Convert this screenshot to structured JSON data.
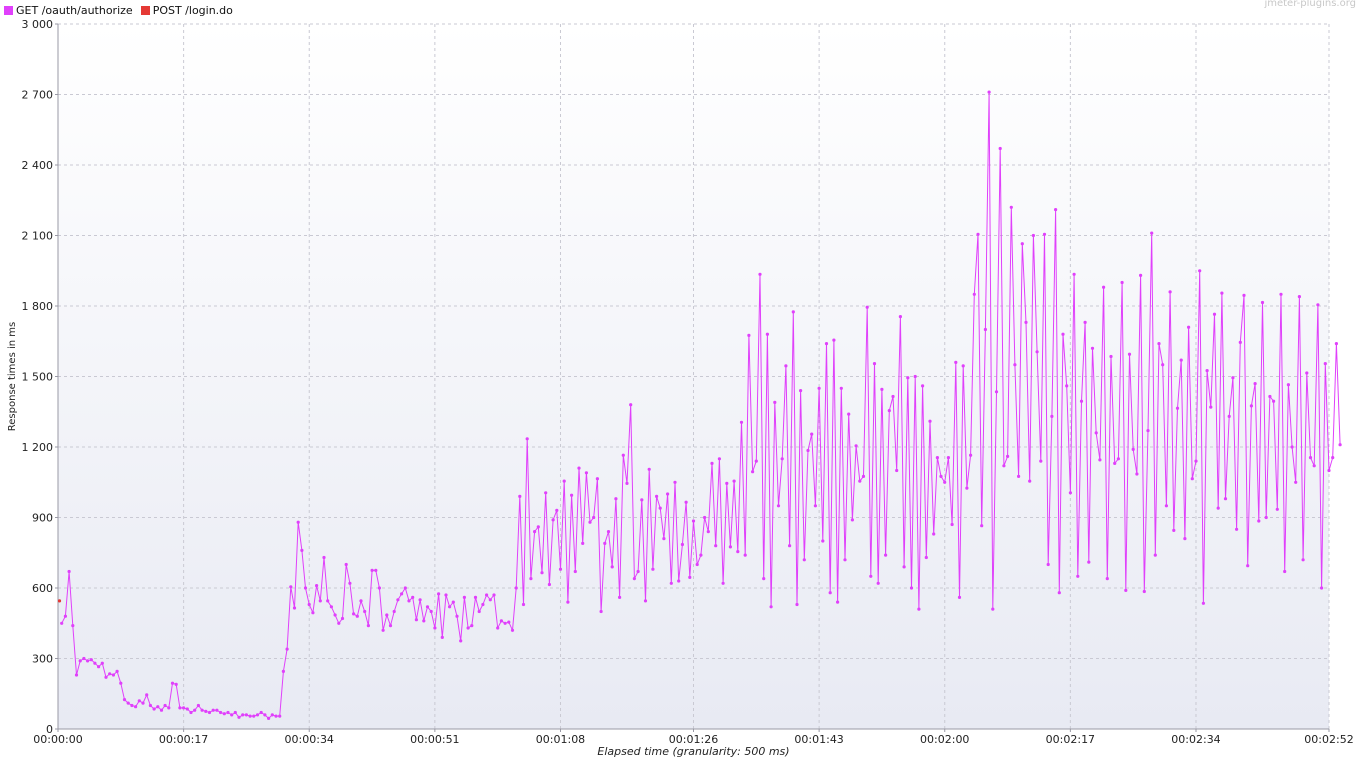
{
  "legend": {
    "items": [
      {
        "label": "GET /oauth/authorize",
        "color": "#e040fb"
      },
      {
        "label": "POST /login.do",
        "color": "#e53935"
      }
    ]
  },
  "watermark": "jmeter-plugins.org",
  "chart_data": {
    "type": "line",
    "title": "",
    "xlabel": "Elapsed time (granularity: 500 ms)",
    "ylabel": "Response times in ms",
    "xlim": [
      0,
      172
    ],
    "ylim": [
      0,
      3000
    ],
    "yticks": [
      0,
      300,
      600,
      900,
      1200,
      1500,
      1800,
      2100,
      2400,
      2700,
      3000
    ],
    "ytick_labels": [
      "0",
      "300",
      "600",
      "900",
      "1 200",
      "1 500",
      "1 800",
      "2 100",
      "2 400",
      "2 700",
      "3 000"
    ],
    "xticks": [
      0,
      17,
      34,
      51,
      68,
      86,
      103,
      120,
      137,
      154,
      172
    ],
    "xtick_labels": [
      "00:00:00",
      "00:00:17",
      "00:00:34",
      "00:00:51",
      "00:01:08",
      "00:01:26",
      "00:01:43",
      "00:02:00",
      "00:02:17",
      "00:02:34",
      "00:02:52"
    ],
    "grid": true,
    "legend_position": "top-left",
    "series": [
      {
        "name": "GET /oauth/authorize",
        "color": "#e040fb",
        "x_start": 0.5,
        "x_step": 0.5,
        "values": [
          450,
          480,
          670,
          440,
          230,
          290,
          300,
          290,
          295,
          280,
          265,
          280,
          220,
          235,
          230,
          245,
          195,
          125,
          110,
          100,
          95,
          120,
          110,
          145,
          100,
          85,
          95,
          80,
          100,
          90,
          195,
          190,
          90,
          90,
          85,
          70,
          80,
          100,
          80,
          75,
          70,
          80,
          80,
          70,
          65,
          70,
          60,
          70,
          50,
          60,
          60,
          55,
          55,
          60,
          70,
          60,
          45,
          60,
          55,
          55,
          245,
          340,
          605,
          515,
          880,
          760,
          600,
          530,
          495,
          610,
          545,
          730,
          545,
          520,
          485,
          450,
          470,
          700,
          620,
          490,
          480,
          545,
          500,
          440,
          675,
          675,
          600,
          420,
          485,
          440,
          500,
          550,
          575,
          600,
          545,
          560,
          465,
          550,
          460,
          520,
          500,
          430,
          575,
          390,
          570,
          520,
          540,
          480,
          375,
          560,
          430,
          440,
          560,
          500,
          530,
          570,
          550,
          570,
          430,
          460,
          450,
          455,
          420,
          600,
          990,
          530,
          1235,
          640,
          840,
          860,
          665,
          1005,
          615,
          890,
          930,
          680,
          1055,
          540,
          995,
          670,
          1110,
          790,
          1090,
          880,
          900,
          1065,
          500,
          790,
          840,
          690,
          980,
          560,
          1165,
          1045,
          1380,
          640,
          670,
          975,
          545,
          1105,
          680,
          990,
          940,
          810,
          1000,
          620,
          1050,
          630,
          785,
          965,
          645,
          885,
          700,
          740,
          900,
          840,
          1130,
          780,
          1150,
          620,
          1045,
          775,
          1055,
          755,
          1305,
          740,
          1675,
          1095,
          1140,
          1935,
          640,
          1680,
          520,
          1390,
          950,
          1150,
          1545,
          780,
          1775,
          530,
          1440,
          720,
          1185,
          1255,
          950,
          1450,
          800,
          1640,
          580,
          1655,
          540,
          1450,
          720,
          1340,
          890,
          1205,
          1055,
          1075,
          1795,
          650,
          1555,
          620,
          1445,
          740,
          1355,
          1415,
          1100,
          1755,
          690,
          1495,
          600,
          1500,
          510,
          1460,
          730,
          1310,
          830,
          1155,
          1075,
          1050,
          1155,
          870,
          1560,
          560,
          1545,
          1025,
          1165,
          1850,
          2105,
          865,
          1700,
          2710,
          510,
          1435,
          2470,
          1120,
          1160,
          2220,
          1550,
          1075,
          2065,
          1730,
          1055,
          2100,
          1605,
          1140,
          2105,
          700,
          1330,
          2210,
          580,
          1680,
          1460,
          1005,
          1935,
          650,
          1395,
          1730,
          710,
          1620,
          1260,
          1145,
          1880,
          640,
          1585,
          1130,
          1150,
          1900,
          590,
          1595,
          1190,
          1085,
          1930,
          585,
          1270,
          2110,
          740,
          1640,
          1550,
          950,
          1860,
          845,
          1365,
          1570,
          810,
          1710,
          1065,
          1140,
          1950,
          535,
          1525,
          1370,
          1765,
          940,
          1855,
          980,
          1330,
          1495,
          850,
          1645,
          1845,
          695,
          1375,
          1470,
          885,
          1815,
          900,
          1415,
          1395,
          935,
          1850,
          670,
          1465,
          1200,
          1050,
          1840,
          720,
          1515,
          1155,
          1120,
          1805,
          600,
          1555,
          1100,
          1155,
          1640,
          1210
        ]
      },
      {
        "name": "POST /login.do",
        "color": "#e53935",
        "x_start": 0.2,
        "x_step": 0.5,
        "values": [
          545
        ]
      }
    ]
  }
}
